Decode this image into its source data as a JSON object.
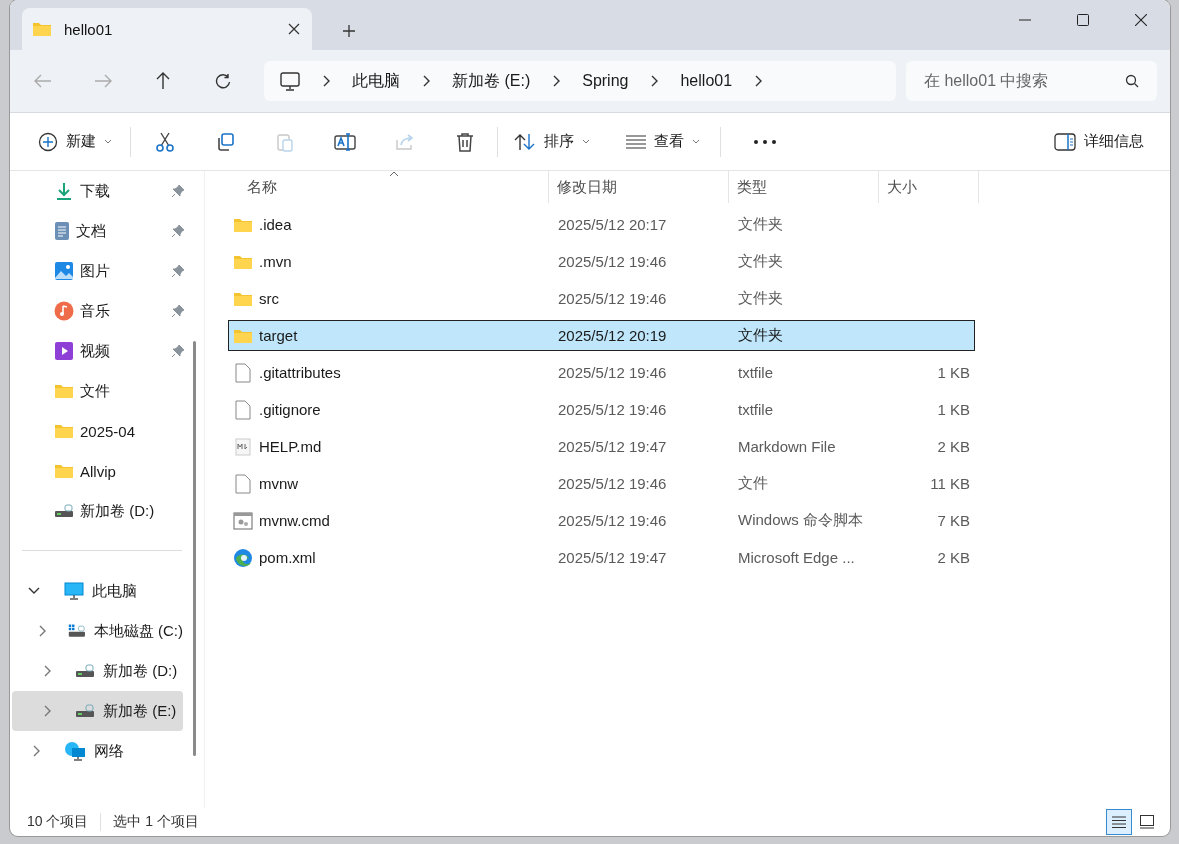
{
  "tab": {
    "title": "hello01"
  },
  "address": {
    "crumbs": [
      "此电脑",
      "新加卷 (E:)",
      "Spring",
      "hello01"
    ]
  },
  "search": {
    "placeholder": "在 hello01 中搜索"
  },
  "toolbar": {
    "new_label": "新建",
    "actions": [
      {
        "kind": "cut",
        "disabled": false
      },
      {
        "kind": "copy",
        "disabled": false
      },
      {
        "kind": "paste",
        "disabled": true
      },
      {
        "kind": "rename",
        "disabled": false
      },
      {
        "kind": "share",
        "disabled": true
      },
      {
        "kind": "delete",
        "disabled": false
      }
    ],
    "sort_label": "排序",
    "view_label": "查看",
    "details_label": "详细信息"
  },
  "sidebar": {
    "quick_access": [
      {
        "label": "下载",
        "kind": "download",
        "pinned": true
      },
      {
        "label": "文档",
        "kind": "document",
        "pinned": true
      },
      {
        "label": "图片",
        "kind": "image",
        "pinned": true
      },
      {
        "label": "音乐",
        "kind": "music",
        "pinned": true
      },
      {
        "label": "视频",
        "kind": "video",
        "pinned": true
      },
      {
        "label": "文件",
        "kind": "folder",
        "pinned": false
      },
      {
        "label": "2025-04",
        "kind": "folder",
        "pinned": false
      },
      {
        "label": "Allvip",
        "kind": "folder",
        "pinned": false
      },
      {
        "label": "新加卷 (D:)",
        "kind": "drive",
        "pinned": false
      }
    ],
    "tree": [
      {
        "label": "此电脑",
        "kind": "computer",
        "expanded": true,
        "selected": false,
        "children": [
          {
            "label": "本地磁盘 (C:)",
            "kind": "system-drive",
            "expanded": false,
            "selected": false
          },
          {
            "label": "新加卷 (D:)",
            "kind": "drive",
            "expanded": false,
            "selected": false
          },
          {
            "label": "新加卷 (E:)",
            "kind": "drive",
            "expanded": false,
            "selected": true
          }
        ]
      },
      {
        "label": "网络",
        "kind": "network",
        "expanded": false,
        "selected": false
      }
    ]
  },
  "table": {
    "columns": [
      {
        "label": "名称",
        "sorted": true
      },
      {
        "label": "修改日期",
        "sorted": false
      },
      {
        "label": "类型",
        "sorted": false
      },
      {
        "label": "大小",
        "sorted": false
      }
    ],
    "rows": [
      {
        "name": ".idea",
        "modified": "2025/5/12 20:17",
        "type": "文件夹",
        "size": "",
        "kind": "folder",
        "selected": false
      },
      {
        "name": ".mvn",
        "modified": "2025/5/12 19:46",
        "type": "文件夹",
        "size": "",
        "kind": "folder",
        "selected": false
      },
      {
        "name": "src",
        "modified": "2025/5/12 19:46",
        "type": "文件夹",
        "size": "",
        "kind": "folder",
        "selected": false
      },
      {
        "name": "target",
        "modified": "2025/5/12 20:19",
        "type": "文件夹",
        "size": "",
        "kind": "folder",
        "selected": true
      },
      {
        "name": ".gitattributes",
        "modified": "2025/5/12 19:46",
        "type": "txtfile",
        "size": "1 KB",
        "kind": "file",
        "selected": false
      },
      {
        "name": ".gitignore",
        "modified": "2025/5/12 19:46",
        "type": "txtfile",
        "size": "1 KB",
        "kind": "file",
        "selected": false
      },
      {
        "name": "HELP.md",
        "modified": "2025/5/12 19:47",
        "type": "Markdown File",
        "size": "2 KB",
        "kind": "markdown",
        "selected": false
      },
      {
        "name": "mvnw",
        "modified": "2025/5/12 19:46",
        "type": "文件",
        "size": "11 KB",
        "kind": "file",
        "selected": false
      },
      {
        "name": "mvnw.cmd",
        "modified": "2025/5/12 19:46",
        "type": "Windows 命令脚本",
        "size": "7 KB",
        "kind": "script",
        "selected": false
      },
      {
        "name": "pom.xml",
        "modified": "2025/5/12 19:47",
        "type": "Microsoft Edge ...",
        "size": "2 KB",
        "kind": "edge",
        "selected": false
      }
    ]
  },
  "status": {
    "count": "10 个项目",
    "selection": "选中 1 个项目"
  },
  "view_modes": [
    {
      "kind": "details",
      "selected": true
    },
    {
      "kind": "tiles",
      "selected": false
    }
  ]
}
